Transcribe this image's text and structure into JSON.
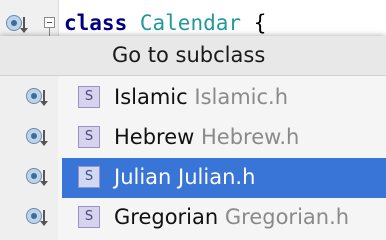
{
  "editor": {
    "keyword": "class",
    "class_name": "Calendar",
    "brace": "{"
  },
  "popup": {
    "title": "Go to subclass",
    "items": [
      {
        "name": "Islamic",
        "file": "Islamic.h",
        "icon": "class-icon",
        "icon_letter": "S",
        "selected": false
      },
      {
        "name": "Hebrew",
        "file": "Hebrew.h",
        "icon": "class-icon",
        "icon_letter": "S",
        "selected": false
      },
      {
        "name": "Julian",
        "file": "Julian.h",
        "icon": "class-icon",
        "icon_letter": "S",
        "selected": true
      },
      {
        "name": "Gregorian",
        "file": "Gregorian.h",
        "icon": "class-icon",
        "icon_letter": "S",
        "selected": false
      }
    ]
  },
  "colors": {
    "selection": "#3875d7",
    "keyword": "#000080",
    "class_name": "#20999d",
    "file_hint": "#8a8a8a"
  }
}
